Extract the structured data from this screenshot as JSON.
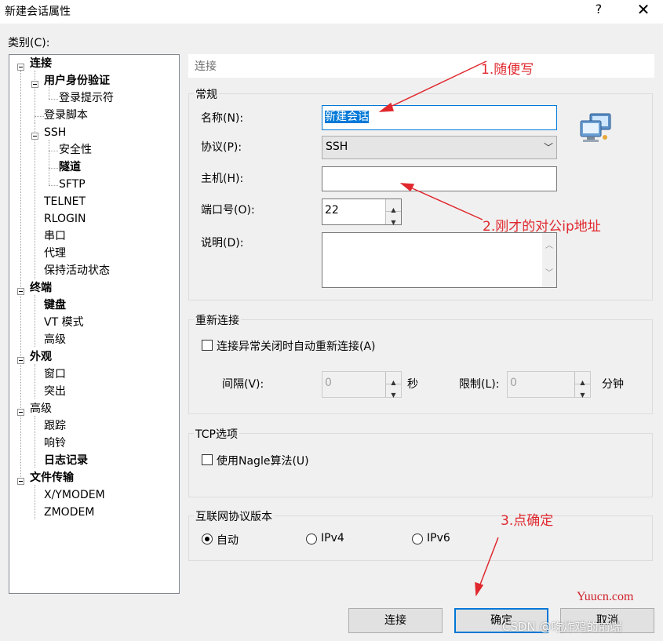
{
  "window": {
    "title": "新建会话属性",
    "help": "?",
    "close": "✕"
  },
  "category_label": "类别(C):",
  "tree": [
    {
      "label": "连接",
      "bold": true
    },
    {
      "label": "用户身份验证",
      "bold": true
    },
    {
      "label": "登录提示符",
      "bold": false
    },
    {
      "label": "登录脚本",
      "bold": false
    },
    {
      "label": "SSH",
      "bold": false
    },
    {
      "label": "安全性",
      "bold": false
    },
    {
      "label": "隧道",
      "bold": true
    },
    {
      "label": "SFTP",
      "bold": false
    },
    {
      "label": "TELNET",
      "bold": false
    },
    {
      "label": "RLOGIN",
      "bold": false
    },
    {
      "label": "串口",
      "bold": false
    },
    {
      "label": "代理",
      "bold": false
    },
    {
      "label": "保持活动状态",
      "bold": false
    },
    {
      "label": "终端",
      "bold": true
    },
    {
      "label": "键盘",
      "bold": true
    },
    {
      "label": "VT 模式",
      "bold": false
    },
    {
      "label": "高级",
      "bold": false
    },
    {
      "label": "外观",
      "bold": true
    },
    {
      "label": "窗口",
      "bold": false
    },
    {
      "label": "突出",
      "bold": false
    },
    {
      "label": "高级",
      "bold": false
    },
    {
      "label": "跟踪",
      "bold": false
    },
    {
      "label": "响铃",
      "bold": false
    },
    {
      "label": "日志记录",
      "bold": true
    },
    {
      "label": "文件传输",
      "bold": true
    },
    {
      "label": "X/YMODEM",
      "bold": false
    },
    {
      "label": "ZMODEM",
      "bold": false
    }
  ],
  "header": "连接",
  "general": {
    "title": "常规",
    "name_label": "名称(N):",
    "name_value": "新建会话",
    "protocol_label": "协议(P):",
    "protocol_value": "SSH",
    "host_label": "主机(H):",
    "host_value": "",
    "port_label": "端口号(O):",
    "port_value": "22",
    "desc_label": "说明(D):",
    "desc_value": ""
  },
  "reconnect": {
    "title": "重新连接",
    "auto_label": "连接异常关闭时自动重新连接(A)",
    "auto_checked": false,
    "interval_label": "间隔(V):",
    "interval_value": "0",
    "interval_unit": "秒",
    "limit_label": "限制(L):",
    "limit_value": "0",
    "limit_unit": "分钟"
  },
  "tcp": {
    "title": "TCP选项",
    "nagle_label": "使用Nagle算法(U)",
    "nagle_checked": false
  },
  "ip_version": {
    "title": "互联网协议版本",
    "options": [
      "自动",
      "IPv4",
      "IPv6"
    ],
    "selected": "自动"
  },
  "buttons": {
    "connect": "连接",
    "ok": "确定",
    "cancel": "取消"
  },
  "annotations": {
    "a1": "1.随便写",
    "a2": "2.刚才的对公ip地址",
    "a3": "3.点确定",
    "color": "#e0282e"
  },
  "watermarks": {
    "yuucn": "Yuucn.com",
    "csdn": "CSDN @吃炸鸡的前端"
  },
  "colors": {
    "accent": "#0078d7",
    "panel": "#f0f0f0"
  }
}
